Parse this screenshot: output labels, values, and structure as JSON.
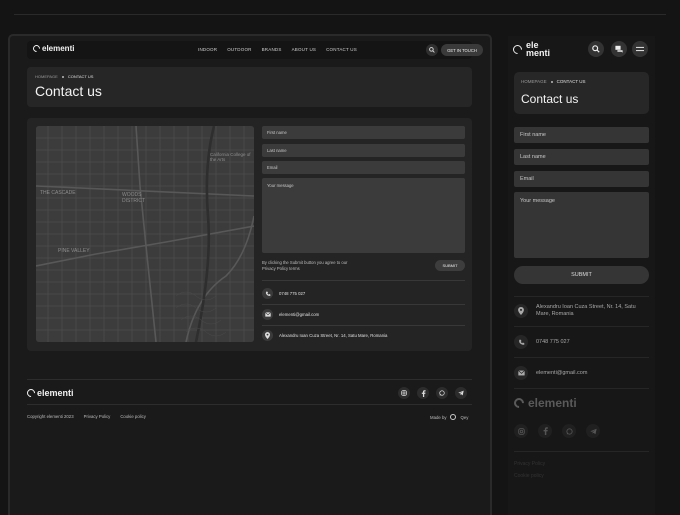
{
  "brand": {
    "name": "elementi",
    "mobile_line1": "ele",
    "mobile_line2": "menti"
  },
  "nav": {
    "links": [
      "INDOOR",
      "OUTDOOR",
      "BRANDS",
      "ABOUT US",
      "CONTACT US"
    ],
    "cta": "GET IN TOUCH"
  },
  "hero": {
    "crumb_home": "HOMEPAGE",
    "crumb_current": "CONTACT US",
    "title": "Contact us"
  },
  "form": {
    "first_name": "First name",
    "last_name": "Last name",
    "email": "Email",
    "message": "Your message",
    "consent": "By clicking the Submit button you agree to our Privacy Policy terms",
    "submit": "SUBMIT"
  },
  "contact": {
    "phone": "0748 775 027",
    "email": "elementi@gmail.com",
    "address": "Alexandru Ioan Cuza Street, Nr. 14, Satu Mare, Romania",
    "address_mobile": "Alexandru Ioan Cuza Street, Nr. 14, Satu Mare, Romania"
  },
  "map": {
    "labels": [
      "THE CASCADE",
      "WOODS DISTRICT",
      "PINE VALLEY",
      "California College of the Arts"
    ]
  },
  "footer": {
    "copyright": "Copyright elementi 2023",
    "privacy": "Privacy Policy",
    "cookie": "Cookie policy",
    "made_by": "Made by",
    "studio": "Qey"
  },
  "colors": {
    "page": "#141414",
    "panel": "#1a1a1a",
    "card": "#242424",
    "input": "#3b3b3b",
    "text": "#e6e6e6"
  }
}
